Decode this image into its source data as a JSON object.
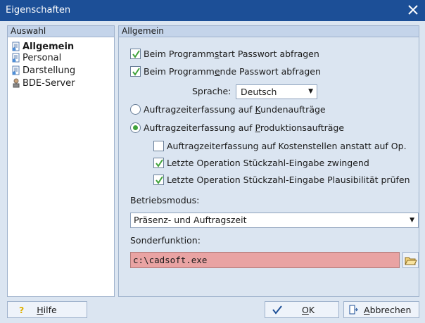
{
  "window": {
    "title": "Eigenschaften"
  },
  "left_panel": {
    "header": "Auswahl",
    "items": [
      {
        "label": "Allgemein",
        "selected": true,
        "icon": "page-icon"
      },
      {
        "label": "Personal",
        "selected": false,
        "icon": "page-icon"
      },
      {
        "label": "Darstellung",
        "selected": false,
        "icon": "page-icon"
      },
      {
        "label": "BDE-Server",
        "selected": false,
        "icon": "person-icon"
      }
    ]
  },
  "right_panel": {
    "header": "Allgemein",
    "checkbox_start": {
      "label_pre": "Beim Programm",
      "label_u": "s",
      "label_post": "tart Passwort abfragen",
      "checked": true
    },
    "checkbox_end": {
      "label_pre": "Beim Programm",
      "label_u": "e",
      "label_post": "nde Passwort abfragen",
      "checked": true
    },
    "language": {
      "label": "Sprache:",
      "value": "Deutsch"
    },
    "radio_customer": {
      "label_pre": "Auftragzeiterfassung auf ",
      "label_u": "K",
      "label_post": "undenaufträge",
      "selected": false
    },
    "radio_production": {
      "label_pre": "Auftragzeiterfassung auf ",
      "label_u": "P",
      "label_post": "roduktionsaufträge",
      "selected": true
    },
    "checkbox_costcenter": {
      "label": "Auftragzeiterfassung auf Kostenstellen anstatt auf Op.",
      "checked": false
    },
    "checkbox_mandatory": {
      "label": "Letzte Operation Stückzahl-Eingabe zwingend",
      "checked": true
    },
    "checkbox_plausibility": {
      "label": "Letzte Operation Stückzahl-Eingabe Plausibilität prüfen",
      "checked": true
    },
    "operating_mode": {
      "label": "Betriebsmodus:",
      "value": "Präsenz- und Auftragszeit"
    },
    "special_function": {
      "label": "Sonderfunktion:",
      "value": "c:\\cadsoft.exe"
    }
  },
  "buttons": {
    "help": {
      "label_u": "H",
      "label_post": "ilfe"
    },
    "ok": {
      "label_u": "O",
      "label_post": "K"
    },
    "cancel": {
      "label_u": "A",
      "label_post": "bbrechen"
    }
  },
  "colors": {
    "titlebar": "#1c4f97",
    "field_highlight": "#e9a3a3",
    "check_green": "#3fa23a"
  }
}
